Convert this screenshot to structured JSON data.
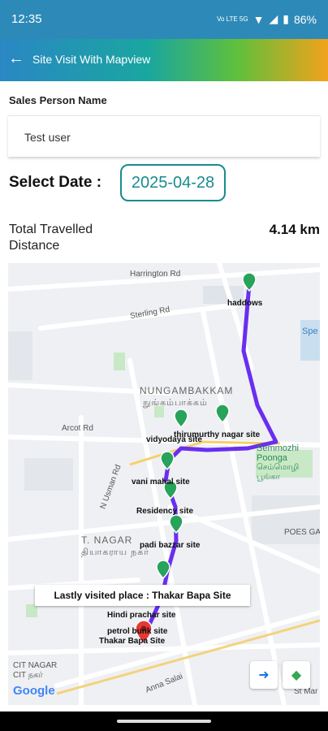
{
  "status": {
    "time": "12:35",
    "signal": "Vo LTE 5G",
    "battery": "86%"
  },
  "appbar": {
    "title": "Site Visit With Mapview"
  },
  "salesperson": {
    "label": "Sales Person Name",
    "value": "Test user"
  },
  "date": {
    "label": "Select Date :",
    "value": "2025-04-28"
  },
  "distance": {
    "label": "Total Travelled Distance",
    "value": "4.14 km"
  },
  "map": {
    "areas": {
      "nungambakkam": "NUNGAMBAKKAM",
      "nungambakkam_ta": "நுங்கம்பாக்கம்",
      "tnagar": "T. NAGAR",
      "tnagar_ta": "தியாகராய நகர்",
      "citnagar": "CIT NAGAR",
      "citnagar_ta": "CIT நகர்",
      "poes": "POES GARD"
    },
    "roads": {
      "harrington": "Harrington Rd",
      "sterling": "Sterling Rd",
      "arcot": "Arcot Rd",
      "usman": "N Usman Rd",
      "anna": "Anna Salai",
      "st_mary": "St Mar"
    },
    "landmarks": {
      "semmozhi": "Semmozhi Poonga",
      "semmozhi_ta": "செம்மொழி பூங்கா",
      "spe": "Spe"
    },
    "sites": {
      "haddows": "haddows",
      "vidyodaya": "vidyodaya site",
      "thirumurthy": "thirumurthy nagar site",
      "vani": "vani mahal site",
      "residency": "Residency site",
      "padi": "padi bazzar site",
      "hindi": "Hindi prachar site",
      "petrol": "petrol bunk site",
      "thakar": "Thakar Bapa Site"
    },
    "callout": "Lastly visited place : Thakar Bapa Site",
    "google": "Google",
    "colors": {
      "route": "#6a2ef0",
      "pin": "#27a35a",
      "lastPin": "#e53935"
    }
  }
}
